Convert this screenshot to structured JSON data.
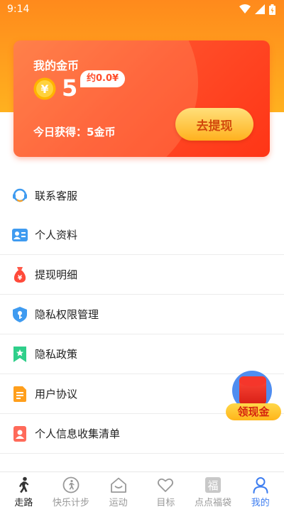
{
  "status_bar": {
    "time": "9:14"
  },
  "wallet": {
    "title": "我的金币",
    "coin_symbol": "¥",
    "balance": "5",
    "approx": "约0.0¥",
    "today": "今日获得：5金币",
    "withdraw_label": "去提现",
    "colors": {
      "card": "#ff4f2a",
      "button": "#ffc23a"
    }
  },
  "menu": {
    "items": [
      {
        "label": "联系客服",
        "icon": "customer-service-icon"
      },
      {
        "label": "个人资料",
        "icon": "id-card-icon"
      },
      {
        "label": "提现明细",
        "icon": "money-bag-icon"
      },
      {
        "label": "隐私权限管理",
        "icon": "shield-key-icon"
      },
      {
        "label": "隐私政策",
        "icon": "bookmark-star-icon"
      },
      {
        "label": "用户协议",
        "icon": "document-icon"
      },
      {
        "label": "个人信息收集清单",
        "icon": "person-list-icon"
      }
    ]
  },
  "float_widget": {
    "label": "领现金",
    "icon": "red-envelope-icon"
  },
  "bottom_nav": {
    "items": [
      {
        "label": "走路",
        "icon": "walking-icon"
      },
      {
        "label": "快乐计步",
        "icon": "pedometer-icon"
      },
      {
        "label": "运动",
        "icon": "house-icon"
      },
      {
        "label": "目标",
        "icon": "heart-icon"
      },
      {
        "label": "点点福袋",
        "icon": "fortune-bag-icon",
        "glyph": "福"
      },
      {
        "label": "我的",
        "icon": "profile-icon"
      }
    ],
    "active_color": "#3d7df0"
  }
}
